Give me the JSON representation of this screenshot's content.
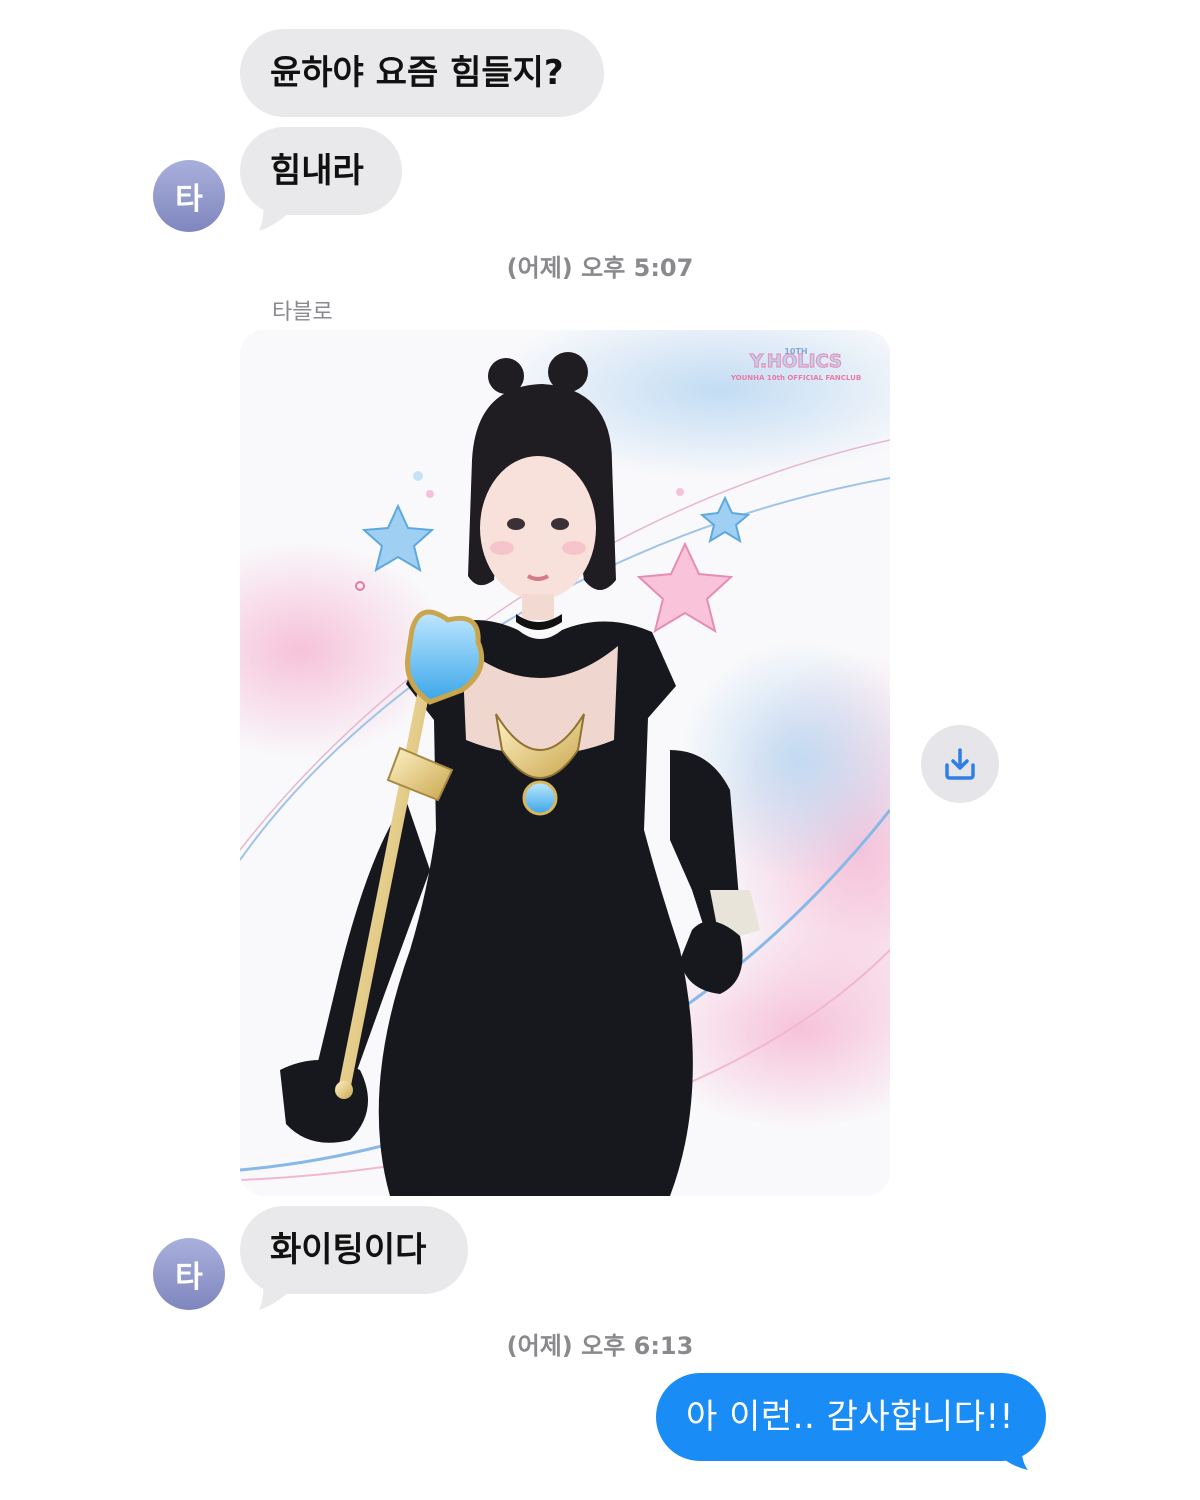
{
  "conversation": {
    "contact_initial": "타",
    "messages_group1": [
      {
        "text": "윤하야 요즘 힘들지?"
      },
      {
        "text": "힘내라"
      }
    ],
    "timestamp1": "(어제) 오후 5:07",
    "sender_name": "타블로",
    "photo": {
      "logo_top": "10TH",
      "logo_main": "Y.HOLICS",
      "logo_sub": "YOUNHA 10th OFFICIAL FANCLUB"
    },
    "save_icon": "download-icon",
    "messages_group2": [
      {
        "text": "화이팅이다"
      }
    ],
    "timestamp2": "(어제) 오후 6:13",
    "outgoing": {
      "text": "아 이런.. 감사합니다!!"
    }
  },
  "colors": {
    "incoming_bubble": "#e9e9eb",
    "outgoing_bubble": "#1a8cf6",
    "avatar": "#8a90c6",
    "timestamp": "#8a8a8e",
    "save_icon": "#2f7fe8"
  }
}
